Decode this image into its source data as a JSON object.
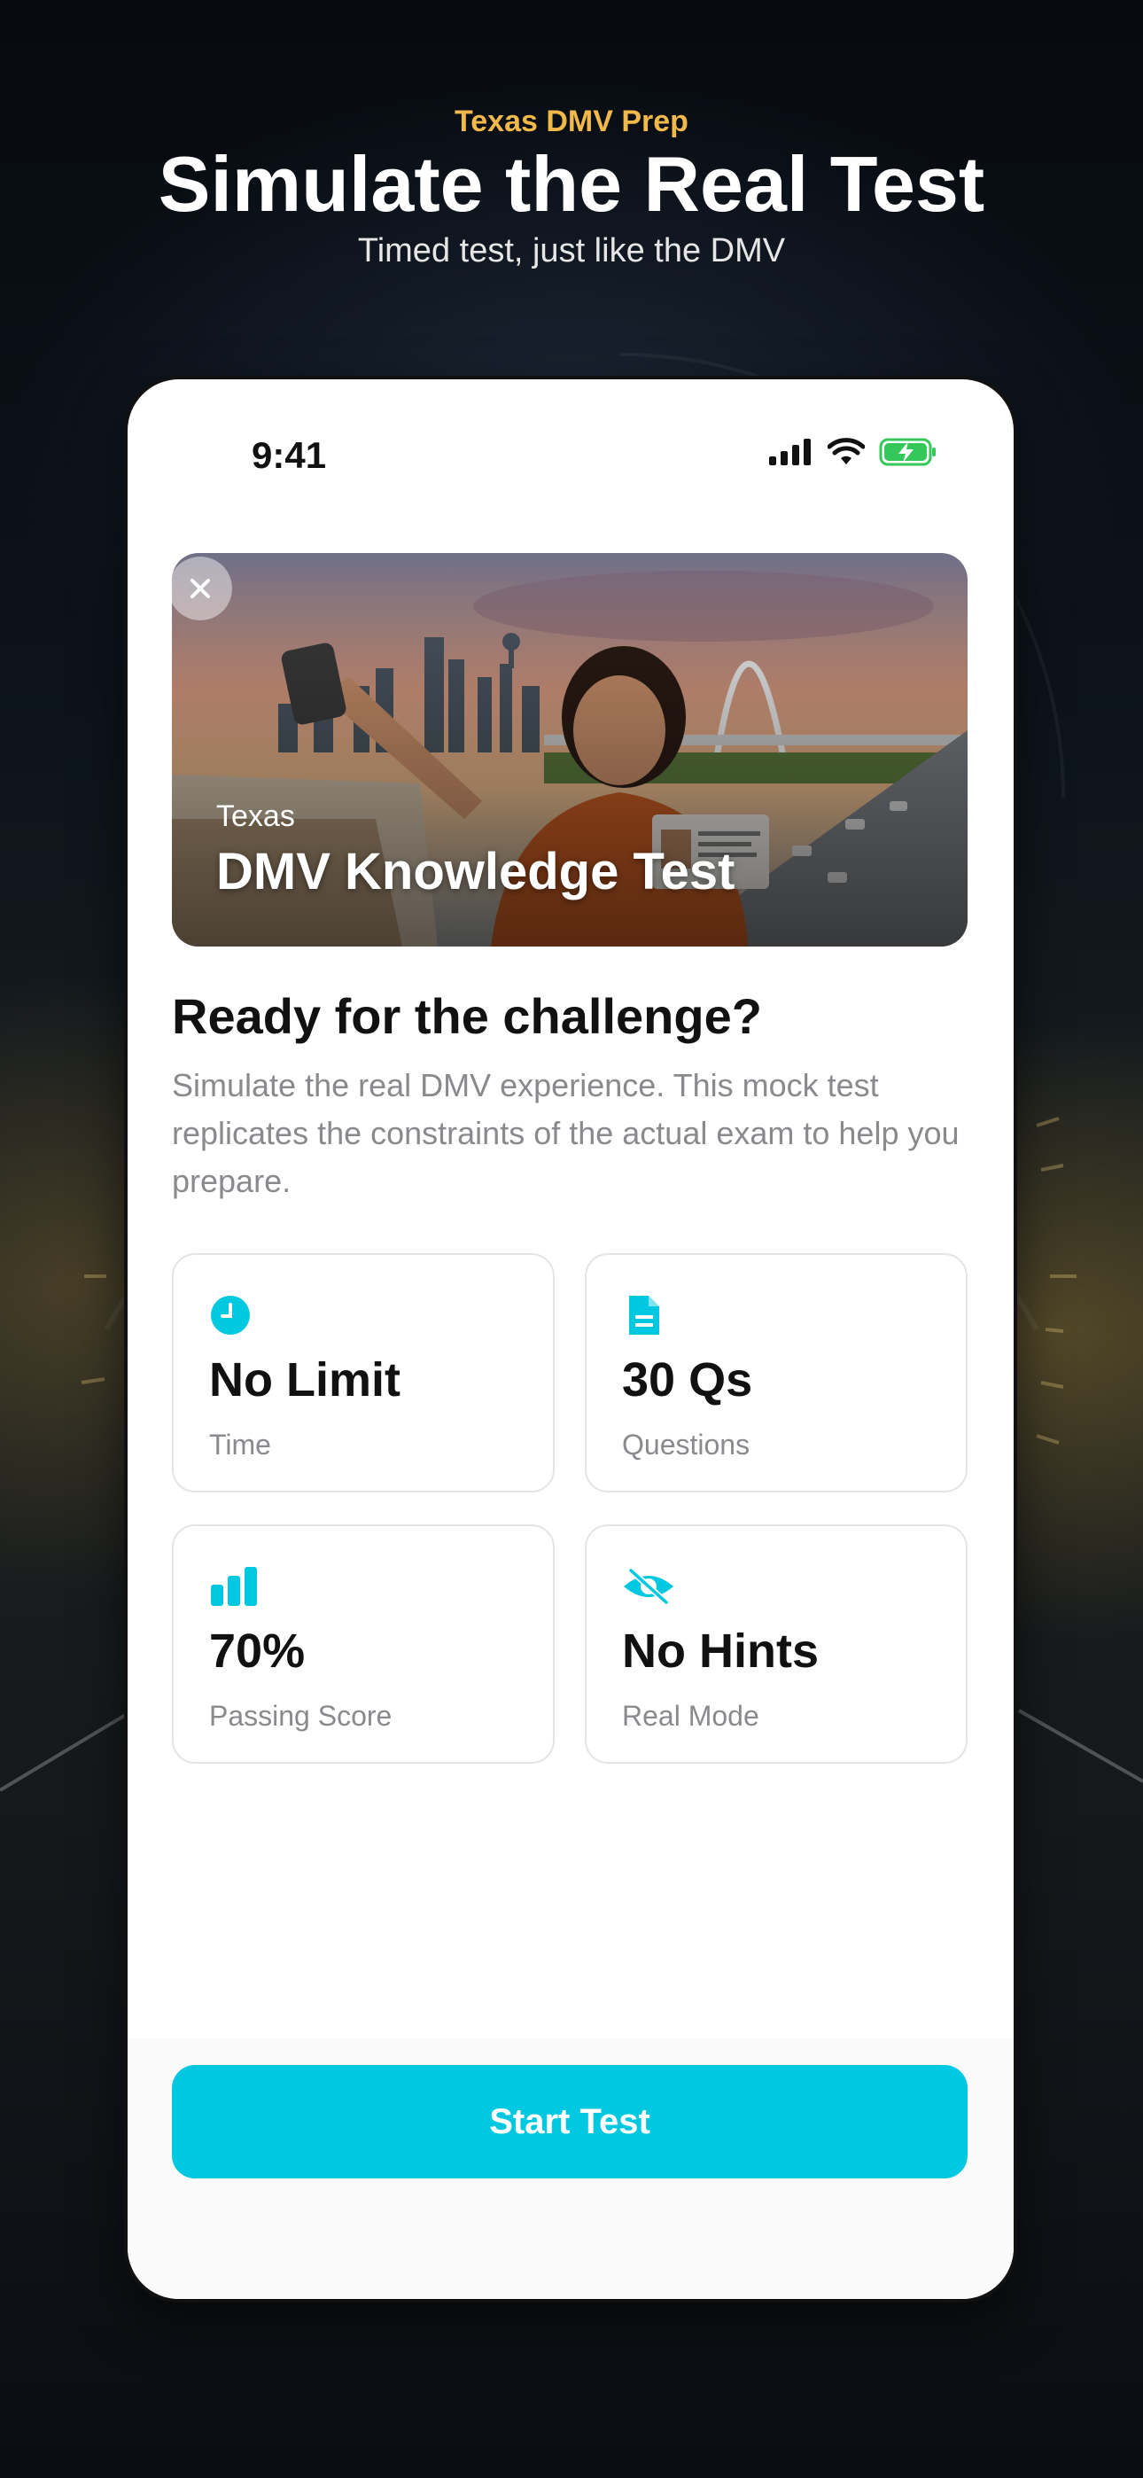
{
  "promo": {
    "subtitle": "Texas DMV Prep",
    "title": "Simulate the Real Test",
    "caption": "Timed test, just like the DMV"
  },
  "status_bar": {
    "time": "9:41",
    "icons": [
      "cellular-signal-icon",
      "wifi-icon",
      "battery-charging-icon"
    ]
  },
  "hero": {
    "kicker": "Texas",
    "title": "DMV Knowledge Test",
    "close_icon": "close-icon"
  },
  "intro": {
    "heading": "Ready for the challenge?",
    "description": "Simulate the real DMV experience. This mock test replicates the constraints of the actual exam to help you prepare."
  },
  "stats": [
    {
      "icon": "clock-icon",
      "value": "No Limit",
      "label": "Time"
    },
    {
      "icon": "document-icon",
      "value": "30 Qs",
      "label": "Questions"
    },
    {
      "icon": "bar-chart-icon",
      "value": "70%",
      "label": "Passing Score"
    },
    {
      "icon": "eye-off-icon",
      "value": "No Hints",
      "label": "Real Mode"
    }
  ],
  "actions": {
    "start_label": "Start Test"
  },
  "colors": {
    "accent": "#00c8e0",
    "promo_subtitle": "#f1b84a",
    "battery_green": "#34c759"
  }
}
